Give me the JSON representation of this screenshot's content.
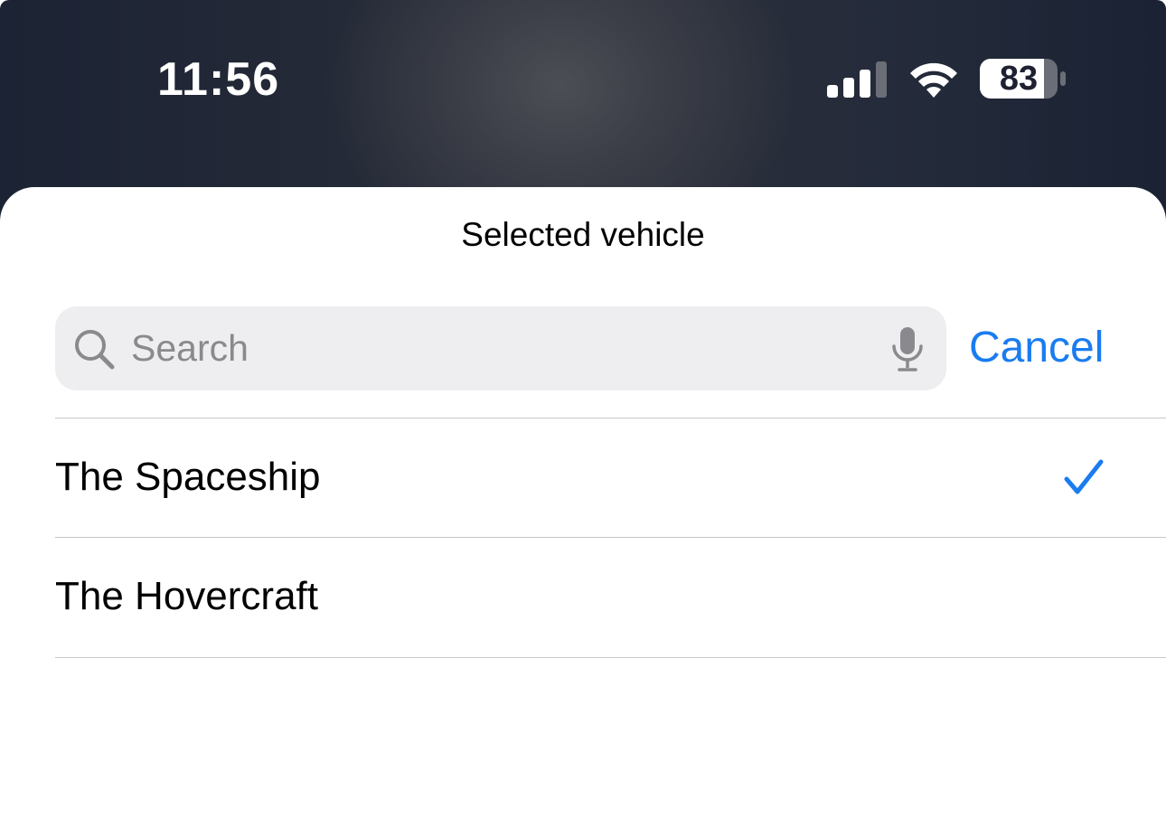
{
  "status_bar": {
    "time": "11:56",
    "battery_percent": "83",
    "signal_bars_filled": 3,
    "signal_bars_total": 4,
    "icons": [
      "cellular-signal-icon",
      "wifi-icon",
      "battery-icon"
    ]
  },
  "sheet": {
    "title": "Selected vehicle"
  },
  "search": {
    "placeholder": "Search",
    "value": "",
    "cancel_label": "Cancel",
    "icons": [
      "search-icon",
      "microphone-icon"
    ]
  },
  "vehicles": [
    {
      "label": "The Spaceship",
      "selected": true
    },
    {
      "label": "The Hovercraft",
      "selected": false
    }
  ],
  "colors": {
    "accent": "#1a7cf0",
    "search_background": "#eeeef0",
    "separator": "#c8c8cc",
    "placeholder": "#8a8a8e"
  }
}
